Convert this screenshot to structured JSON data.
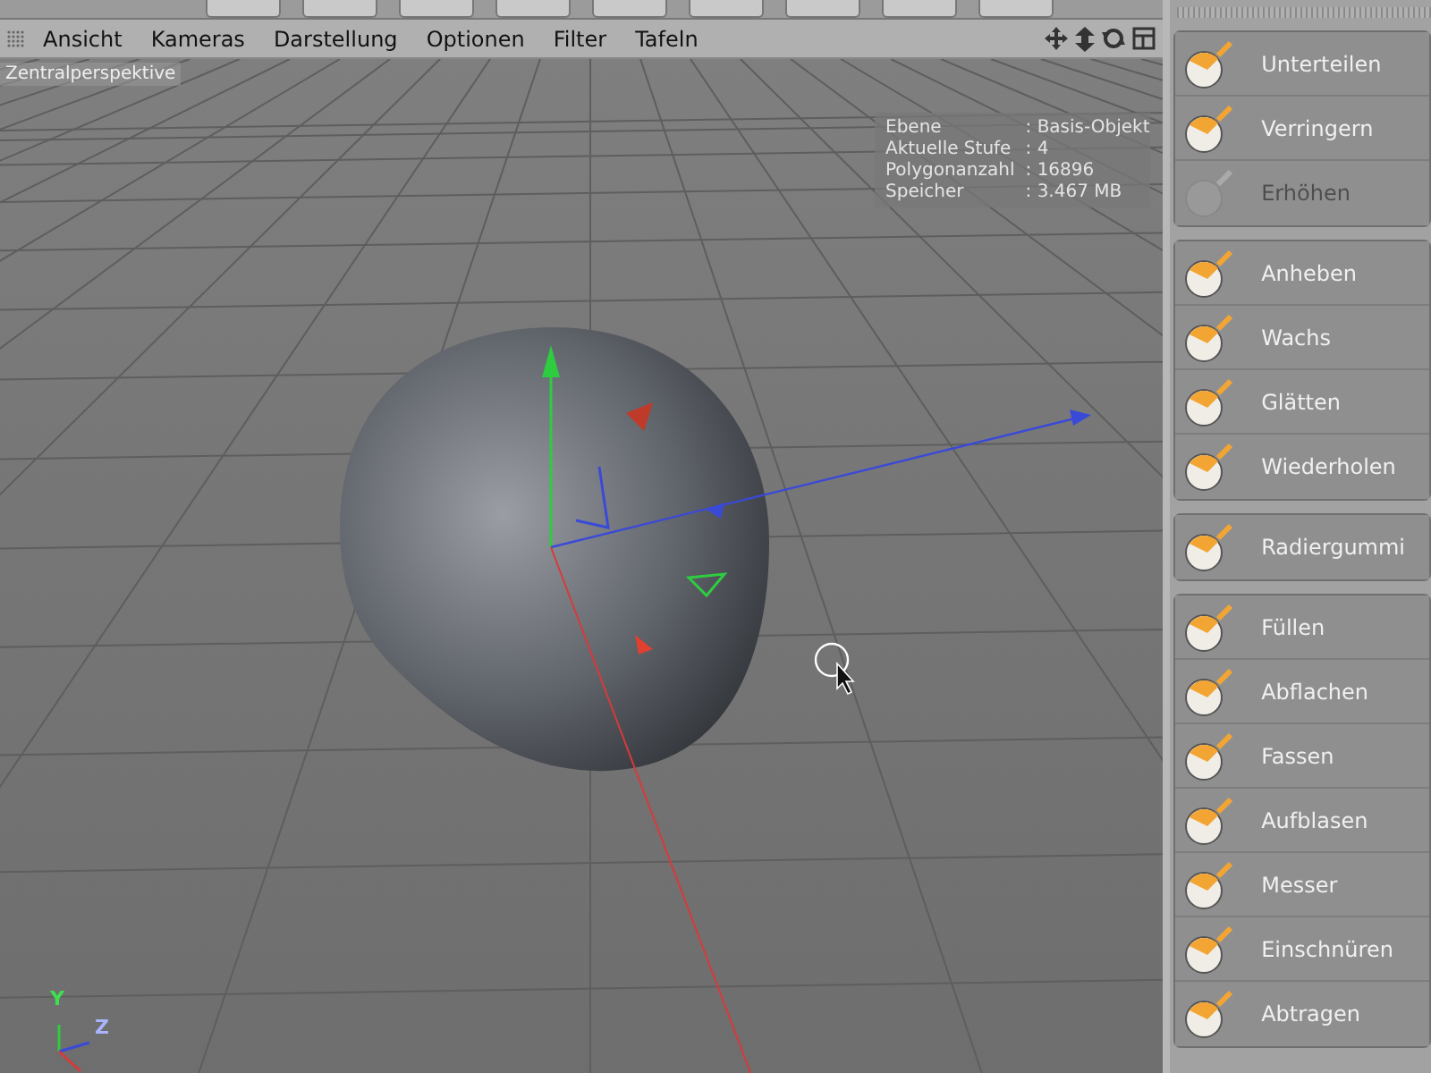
{
  "menu_bar": {
    "items": [
      "Ansicht",
      "Kameras",
      "Darstellung",
      "Optionen",
      "Filter",
      "Tafeln"
    ]
  },
  "viewport": {
    "camera_label": "Zentralperspektive",
    "info": [
      {
        "label": "Ebene",
        "value": ": Basis-Objekt"
      },
      {
        "label": "Aktuelle Stufe",
        "value": ": 4"
      },
      {
        "label": "Polygonanzahl",
        "value": ": 16896"
      },
      {
        "label": "Speicher",
        "value": ": 3.467 MB"
      }
    ],
    "axis_labels": [
      "Y",
      "Z"
    ]
  },
  "tool_panel": {
    "groups": [
      {
        "items": [
          {
            "label": "Unterteilen",
            "disabled": false
          },
          {
            "label": "Verringern",
            "disabled": false
          },
          {
            "label": "Erhöhen",
            "disabled": true
          }
        ]
      },
      {
        "items": [
          {
            "label": "Anheben",
            "disabled": false
          },
          {
            "label": "Wachs",
            "disabled": false
          },
          {
            "label": "Glätten",
            "disabled": false
          },
          {
            "label": "Wiederholen",
            "disabled": false
          }
        ]
      },
      {
        "items": [
          {
            "label": "Radiergummi",
            "disabled": false
          }
        ]
      },
      {
        "items": [
          {
            "label": "Füllen",
            "disabled": false
          },
          {
            "label": "Abflachen",
            "disabled": false
          },
          {
            "label": "Fassen",
            "disabled": false
          },
          {
            "label": "Aufblasen",
            "disabled": false
          },
          {
            "label": "Messer",
            "disabled": false
          },
          {
            "label": "Einschnüren",
            "disabled": false
          },
          {
            "label": "Abtragen",
            "disabled": false
          }
        ]
      }
    ]
  }
}
